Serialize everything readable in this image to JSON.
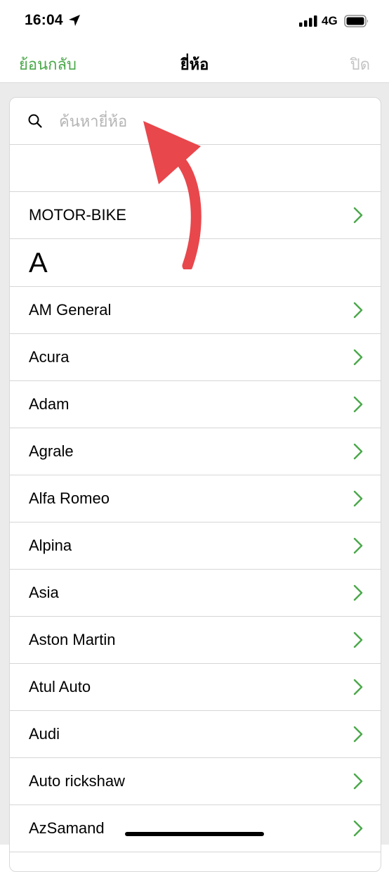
{
  "status_bar": {
    "time": "16:04",
    "network": "4G",
    "icons": [
      "location-arrow-icon",
      "signal-icon",
      "battery-icon"
    ]
  },
  "nav": {
    "back_label": "ย้อนกลับ",
    "title": "ยี่ห้อ",
    "close_label": "ปิด"
  },
  "search": {
    "placeholder": "ค้นหายี่ห้อ",
    "value": ""
  },
  "list": {
    "motorbike_label": "MOTOR-BIKE",
    "section_header": "A",
    "brands": [
      "AM General",
      "Acura",
      "Adam",
      "Agrale",
      "Alfa Romeo",
      "Alpina",
      "Asia",
      "Aston Martin",
      "Atul Auto",
      "Audi",
      "Auto rickshaw",
      "AzSamand"
    ]
  },
  "colors": {
    "accent": "#4aa84a",
    "disabled": "#c4c4c4",
    "background": "#ebebeb",
    "arrow": "#e8474c"
  }
}
